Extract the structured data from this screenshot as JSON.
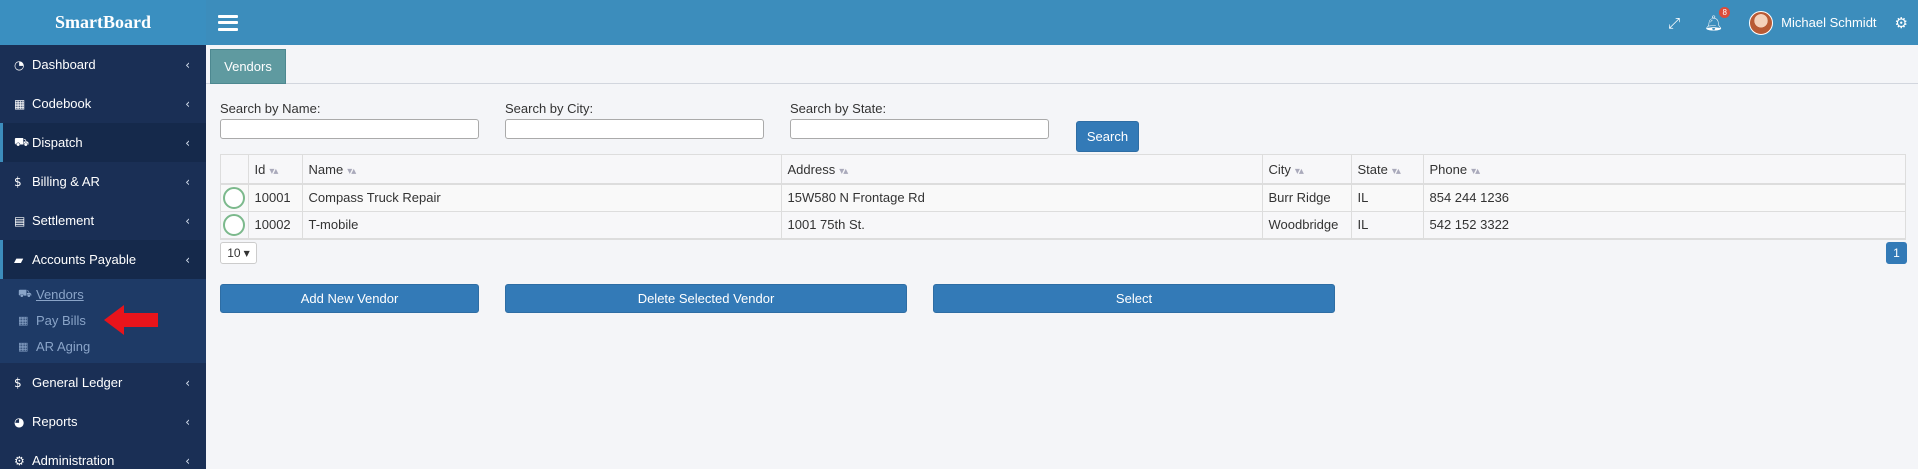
{
  "app": {
    "brand": "SmartBoard"
  },
  "header": {
    "notification_count": "8",
    "user_name": "Michael Schmidt"
  },
  "sidebar": {
    "items": [
      {
        "label": "Dashboard",
        "icon": "dashboard-icon"
      },
      {
        "label": "Codebook",
        "icon": "grid-icon"
      },
      {
        "label": "Dispatch",
        "icon": "truck-icon"
      },
      {
        "label": "Billing & AR",
        "icon": "dollar-icon"
      },
      {
        "label": "Settlement",
        "icon": "calculator-icon"
      },
      {
        "label": "Accounts Payable",
        "icon": "book-icon"
      },
      {
        "label": "General Ledger",
        "icon": "dollar-icon"
      },
      {
        "label": "Reports",
        "icon": "pie-chart-icon"
      },
      {
        "label": "Administration",
        "icon": "cogs-icon"
      }
    ],
    "subitems": [
      {
        "label": "Vendors",
        "icon": "truck-icon"
      },
      {
        "label": "Pay Bills",
        "icon": "table-icon"
      },
      {
        "label": "AR Aging",
        "icon": "table-icon"
      }
    ]
  },
  "tabs": [
    {
      "label": "Vendors"
    }
  ],
  "search": {
    "name_label": "Search by Name:",
    "city_label": "Search by City:",
    "state_label": "Search by State:",
    "name_value": "",
    "city_value": "",
    "state_value": "",
    "button": "Search"
  },
  "table": {
    "columns": [
      "Id",
      "Name",
      "Address",
      "City",
      "State",
      "Phone"
    ],
    "rows": [
      {
        "id": "10001",
        "name": "Compass Truck Repair",
        "address": "15W580 N Frontage Rd",
        "city": "Burr Ridge",
        "state": "IL",
        "phone": "854 244 1236"
      },
      {
        "id": "10002",
        "name": "T-mobile",
        "address": "1001 75th St.",
        "city": "Woodbridge",
        "state": "IL",
        "phone": "542 152 3322"
      }
    ]
  },
  "pagination": {
    "page_size": "10",
    "current_page": "1"
  },
  "actions": {
    "add": "Add New Vendor",
    "delete": "Delete Selected Vendor",
    "select": "Select"
  },
  "colors": {
    "header": "#3c8dbc",
    "sidebar": "#1e3a66",
    "tab": "#5f9aa0",
    "primary_button": "#337ab7",
    "annotation_arrow": "#e8141b"
  }
}
